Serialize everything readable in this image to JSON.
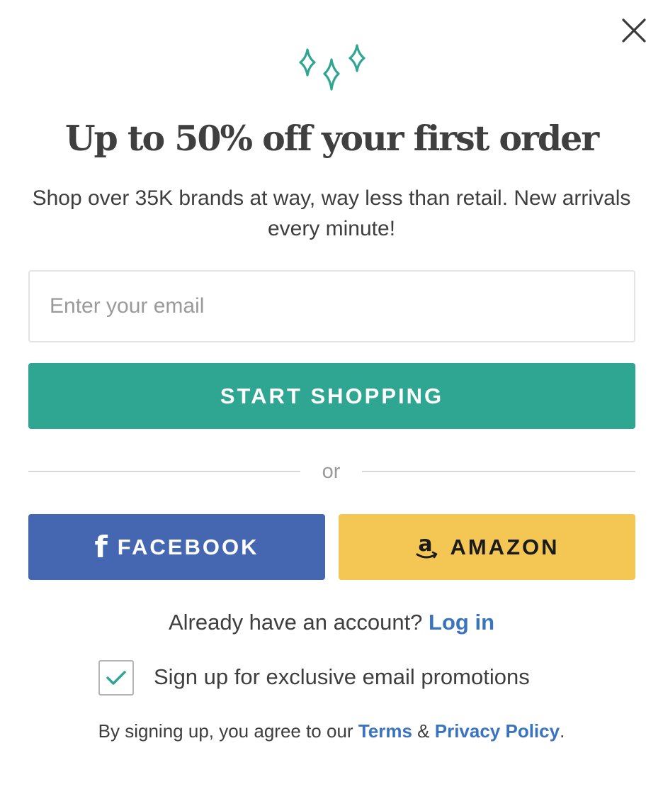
{
  "modal": {
    "close_icon": "close-icon",
    "sparkle_icon": "sparkles-icon",
    "headline": "Up to 50% off your first order",
    "subtext": "Shop over 35K brands at way, way less than retail. New arrivals every minute!",
    "email_placeholder": "Enter your email",
    "email_value": "",
    "primary_button": "START SHOPPING",
    "divider": "or",
    "facebook": {
      "icon": "facebook-f-icon",
      "icon_glyph": "f",
      "label": "FACEBOOK"
    },
    "amazon": {
      "icon": "amazon-icon",
      "label": "AMAZON"
    },
    "account_prompt": "Already have an account?",
    "login_link": "Log in",
    "promo_checkbox": {
      "checked": true,
      "label": "Sign up for exclusive email promotions"
    },
    "legal": {
      "prefix": "By signing up, you agree to our",
      "terms": "Terms",
      "ampersand": "&",
      "privacy": "Privacy Policy",
      "suffix": "."
    }
  },
  "colors": {
    "accent_teal": "#2ea692",
    "facebook_blue": "#4567b1",
    "amazon_yellow": "#f4c653",
    "link_blue": "#3a73c0",
    "heading_text": "#3f3f3f"
  }
}
